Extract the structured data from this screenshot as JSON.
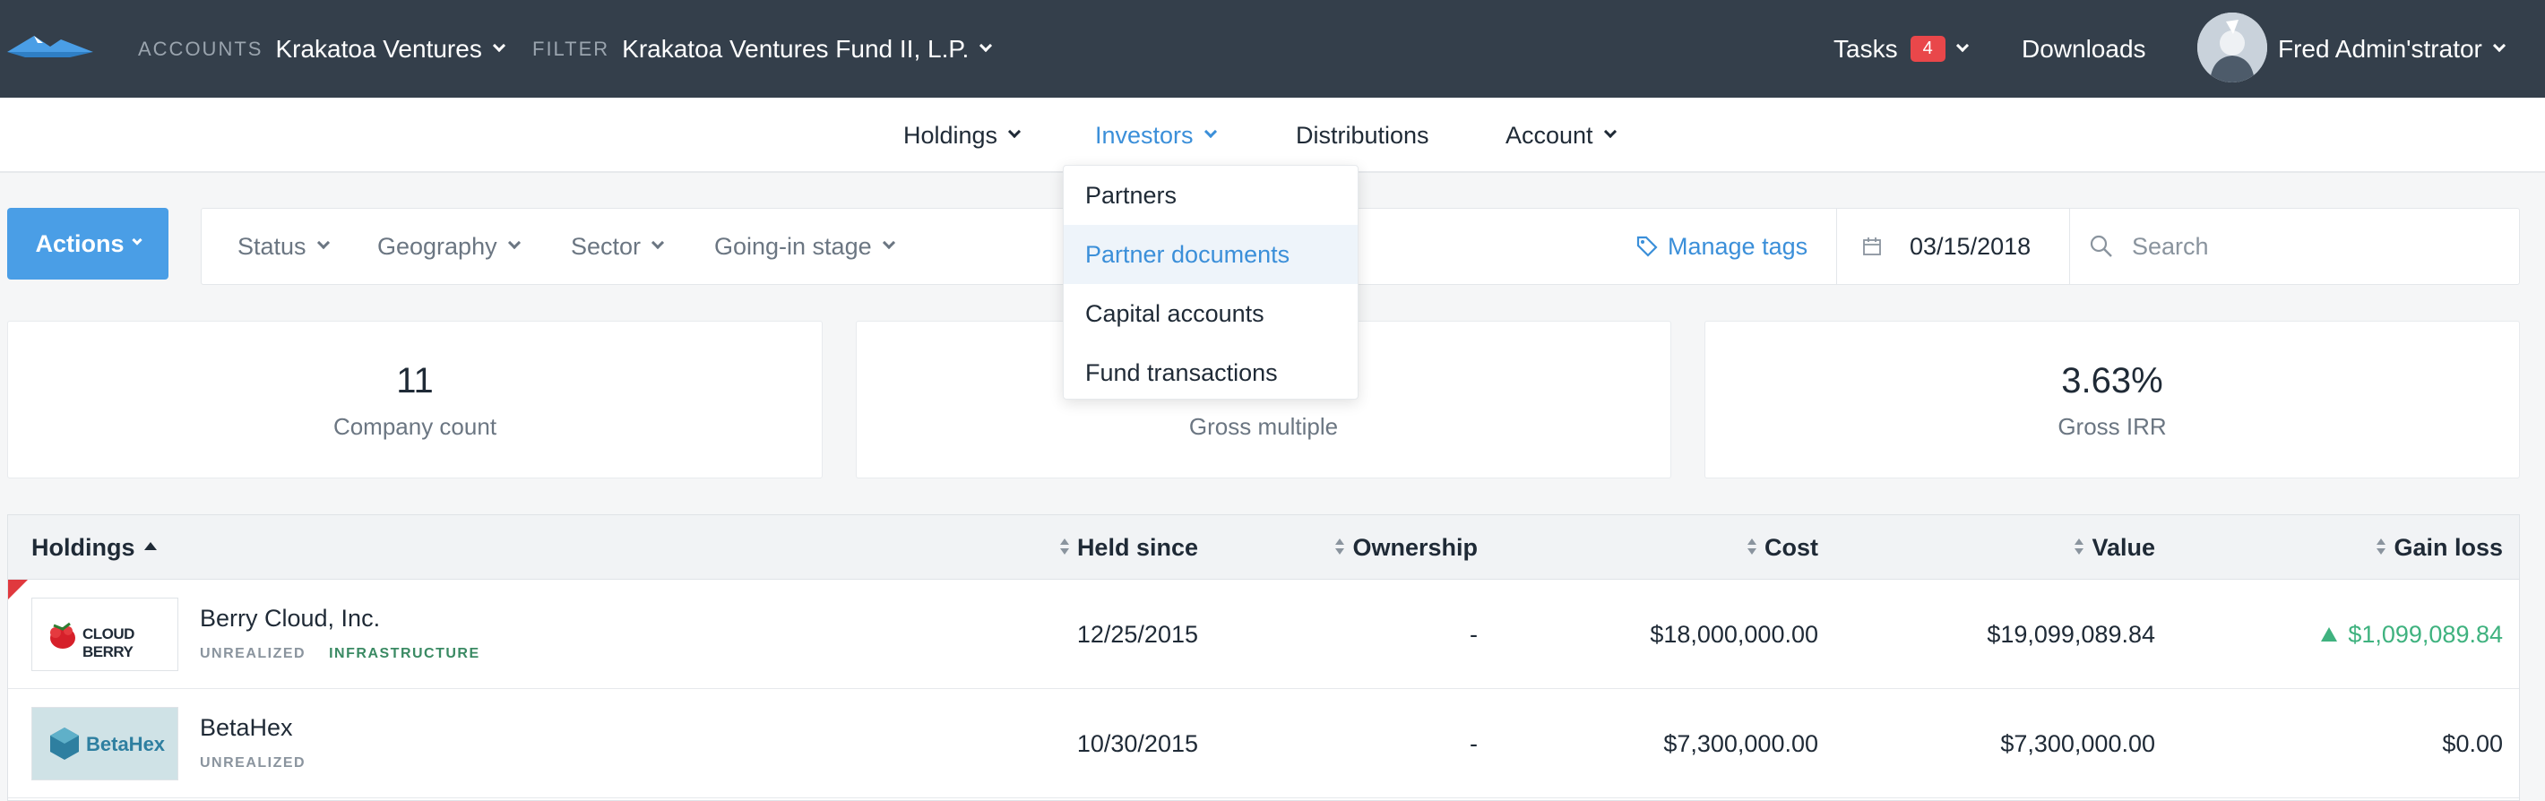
{
  "topbar": {
    "accounts_label": "ACCOUNTS",
    "account_name": "Krakatoa Ventures",
    "filter_label": "FILTER",
    "filter_value": "Krakatoa Ventures Fund II, L.P.",
    "tasks_label": "Tasks",
    "tasks_count": "4",
    "downloads_label": "Downloads",
    "user_name": "Fred Admin'strator"
  },
  "subnav": {
    "items": [
      {
        "label": "Holdings"
      },
      {
        "label": "Investors"
      },
      {
        "label": "Distributions"
      },
      {
        "label": "Account"
      }
    ]
  },
  "investors_menu": {
    "items": [
      {
        "label": "Partners"
      },
      {
        "label": "Partner documents"
      },
      {
        "label": "Capital accounts"
      },
      {
        "label": "Fund transactions"
      }
    ]
  },
  "toolbar": {
    "actions_label": "Actions",
    "filters": [
      {
        "label": "Status"
      },
      {
        "label": "Geography"
      },
      {
        "label": "Sector"
      },
      {
        "label": "Going-in stage"
      }
    ],
    "manage_tags_label": "Manage tags",
    "date_value": "03/15/2018",
    "search_placeholder": "Search"
  },
  "stats": [
    {
      "value": "11",
      "label": "Company count"
    },
    {
      "value": "",
      "label": "Gross multiple"
    },
    {
      "value": "3.63%",
      "label": "Gross IRR"
    }
  ],
  "table": {
    "headers": {
      "holdings": "Holdings",
      "held_since": "Held since",
      "ownership": "Ownership",
      "cost": "Cost",
      "value": "Value",
      "gain_loss": "Gain loss"
    },
    "rows": [
      {
        "logo_text": "CLOUD BERRY",
        "name": "Berry Cloud, Inc.",
        "tags": [
          "UNREALIZED",
          "INFRASTRUCTURE"
        ],
        "held_since": "12/25/2015",
        "ownership": "-",
        "cost": "$18,000,000.00",
        "value": "$19,099,089.84",
        "gain_loss": "$1,099,089.84"
      },
      {
        "logo_text": "BetaHex",
        "name": "BetaHex",
        "tags": [
          "UNREALIZED"
        ],
        "held_since": "10/30/2015",
        "ownership": "-",
        "cost": "$7,300,000.00",
        "value": "$7,300,000.00",
        "gain_loss": "$0.00"
      }
    ]
  },
  "colors": {
    "topbar_bg": "#343f4b",
    "accent_blue": "#3b8fd9",
    "actions_bg": "#4a9ee6",
    "badge_red": "#e9474a",
    "gain_green": "#3fb27f",
    "flag_red": "#e0393e"
  }
}
